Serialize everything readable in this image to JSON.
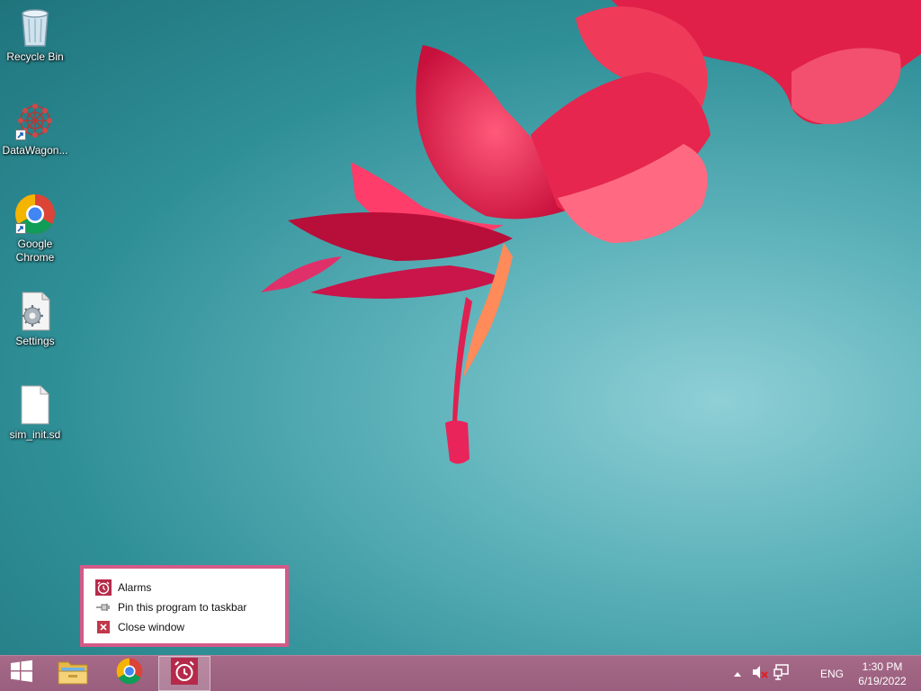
{
  "desktop": {
    "icons": [
      {
        "label": "Recycle Bin",
        "icon": "recycle-bin-icon"
      },
      {
        "label": "DataWagon...",
        "icon": "datawagon-icon"
      },
      {
        "label": "Google Chrome",
        "icon": "chrome-icon"
      },
      {
        "label": "Settings",
        "icon": "settings-file-icon"
      },
      {
        "label": "sim_init.sd",
        "icon": "blank-file-icon"
      }
    ]
  },
  "jumplist": {
    "app_label": "Alarms",
    "pin_label": "Pin this program to taskbar",
    "close_label": "Close window",
    "accent": "#d45a88"
  },
  "taskbar": {
    "buttons": [
      "windows-logo-icon",
      "file-explorer-icon",
      "chrome-icon",
      "alarms-icon"
    ],
    "language": "ENG",
    "time": "1:30 PM",
    "date": "6/19/2022",
    "color": "#9e6282"
  }
}
